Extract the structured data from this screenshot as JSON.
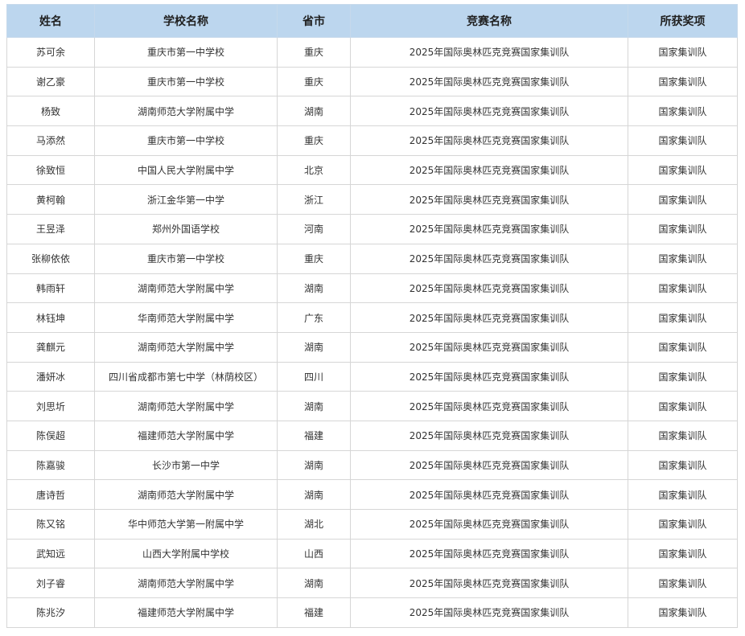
{
  "table": {
    "headers": [
      "姓名",
      "学校名称",
      "省市",
      "竞赛名称",
      "所获奖项"
    ],
    "rows": [
      [
        "苏可余",
        "重庆市第一中学校",
        "重庆",
        "2025年国际奥林匹克竞赛国家集训队",
        "国家集训队"
      ],
      [
        "谢乙豪",
        "重庆市第一中学校",
        "重庆",
        "2025年国际奥林匹克竞赛国家集训队",
        "国家集训队"
      ],
      [
        "杨致",
        "湖南师范大学附属中学",
        "湖南",
        "2025年国际奥林匹克竞赛国家集训队",
        "国家集训队"
      ],
      [
        "马添然",
        "重庆市第一中学校",
        "重庆",
        "2025年国际奥林匹克竞赛国家集训队",
        "国家集训队"
      ],
      [
        "徐致恒",
        "中国人民大学附属中学",
        "北京",
        "2025年国际奥林匹克竞赛国家集训队",
        "国家集训队"
      ],
      [
        "黄柯翰",
        "浙江金华第一中学",
        "浙江",
        "2025年国际奥林匹克竞赛国家集训队",
        "国家集训队"
      ],
      [
        "王昱泽",
        "郑州外国语学校",
        "河南",
        "2025年国际奥林匹克竞赛国家集训队",
        "国家集训队"
      ],
      [
        "张柳依依",
        "重庆市第一中学校",
        "重庆",
        "2025年国际奥林匹克竞赛国家集训队",
        "国家集训队"
      ],
      [
        "韩雨轩",
        "湖南师范大学附属中学",
        "湖南",
        "2025年国际奥林匹克竞赛国家集训队",
        "国家集训队"
      ],
      [
        "林钰坤",
        "华南师范大学附属中学",
        "广东",
        "2025年国际奥林匹克竞赛国家集训队",
        "国家集训队"
      ],
      [
        "龚麒元",
        "湖南师范大学附属中学",
        "湖南",
        "2025年国际奥林匹克竞赛国家集训队",
        "国家集训队"
      ],
      [
        "潘妍冰",
        "四川省成都市第七中学（林荫校区）",
        "四川",
        "2025年国际奥林匹克竞赛国家集训队",
        "国家集训队"
      ],
      [
        "刘思圻",
        "湖南师范大学附属中学",
        "湖南",
        "2025年国际奥林匹克竞赛国家集训队",
        "国家集训队"
      ],
      [
        "陈俣超",
        "福建师范大学附属中学",
        "福建",
        "2025年国际奥林匹克竞赛国家集训队",
        "国家集训队"
      ],
      [
        "陈嘉骏",
        "长沙市第一中学",
        "湖南",
        "2025年国际奥林匹克竞赛国家集训队",
        "国家集训队"
      ],
      [
        "唐诗哲",
        "湖南师范大学附属中学",
        "湖南",
        "2025年国际奥林匹克竞赛国家集训队",
        "国家集训队"
      ],
      [
        "陈又铭",
        "华中师范大学第一附属中学",
        "湖北",
        "2025年国际奥林匹克竞赛国家集训队",
        "国家集训队"
      ],
      [
        "武知远",
        "山西大学附属中学校",
        "山西",
        "2025年国际奥林匹克竞赛国家集训队",
        "国家集训队"
      ],
      [
        "刘子睿",
        "湖南师范大学附属中学",
        "湖南",
        "2025年国际奥林匹克竞赛国家集训队",
        "国家集训队"
      ],
      [
        "陈兆汐",
        "福建师范大学附属中学",
        "福建",
        "2025年国际奥林匹克竞赛国家集训队",
        "国家集训队"
      ]
    ]
  },
  "colors": {
    "header_bg": "#bcd6ee",
    "border": "#d6d6d6"
  }
}
